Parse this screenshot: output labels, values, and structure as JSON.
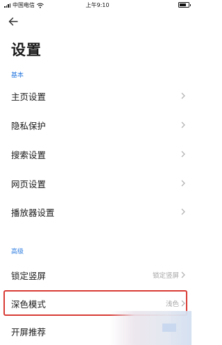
{
  "status_bar": {
    "carrier": "中国电信",
    "time": "上午9:10"
  },
  "header": {
    "back_icon": "arrow-left-icon",
    "title": "设置"
  },
  "sections": [
    {
      "label": "基本",
      "items": [
        {
          "label": "主页设置",
          "value": ""
        },
        {
          "label": "隐私保护",
          "value": ""
        },
        {
          "label": "搜索设置",
          "value": ""
        },
        {
          "label": "网页设置",
          "value": ""
        },
        {
          "label": "播放器设置",
          "value": ""
        }
      ]
    },
    {
      "label": "高级",
      "items": [
        {
          "label": "锁定竖屏",
          "value": "锁定竖屏"
        },
        {
          "label": "深色模式",
          "value": "浅色"
        },
        {
          "label": "开屏推荐",
          "value": ""
        }
      ]
    }
  ],
  "colors": {
    "section_label": "#2b7be0",
    "highlight": "#d83a34",
    "value_text": "#a6a6a6"
  }
}
